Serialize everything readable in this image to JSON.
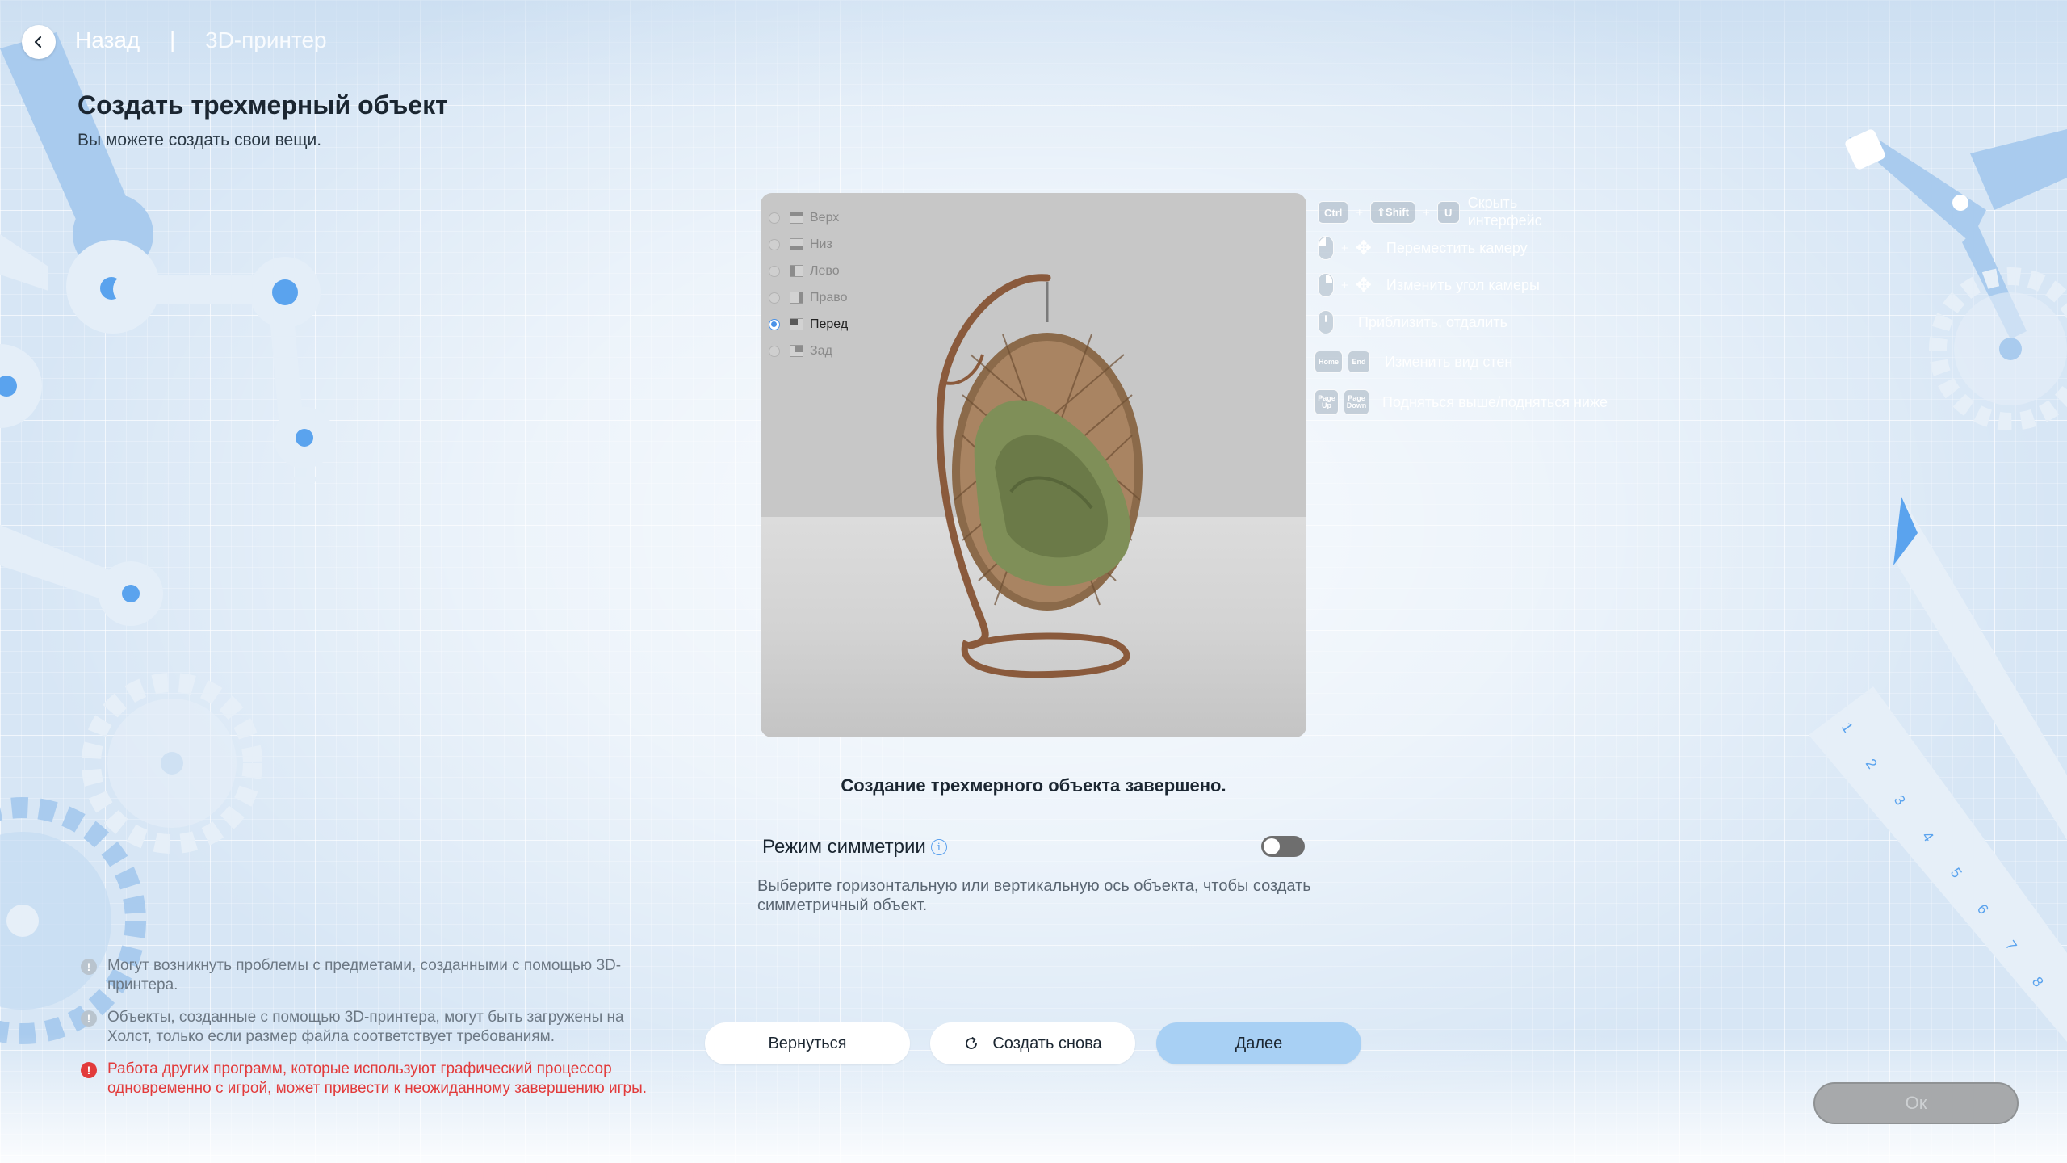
{
  "header": {
    "back_label": "Назад",
    "separator": "|",
    "breadcrumb": "3D-принтер"
  },
  "page": {
    "title": "Создать трехмерный объект",
    "subtitle": "Вы можете создать свои вещи."
  },
  "viewport": {
    "views": [
      {
        "label": "Верх",
        "selected": false,
        "icon": "view-top-icon"
      },
      {
        "label": "Низ",
        "selected": false,
        "icon": "view-bottom-icon"
      },
      {
        "label": "Лево",
        "selected": false,
        "icon": "view-left-icon"
      },
      {
        "label": "Право",
        "selected": false,
        "icon": "view-right-icon"
      },
      {
        "label": "Перед",
        "selected": true,
        "icon": "view-front-icon"
      },
      {
        "label": "Зад",
        "selected": false,
        "icon": "view-back-icon"
      }
    ]
  },
  "controls": {
    "hide_ui": {
      "keys": [
        "Ctrl",
        "⇧Shift",
        "U"
      ],
      "text": "Скрыть интерфейс"
    },
    "move_camera": {
      "text": "Переместить камеру"
    },
    "rotate_camera": {
      "text": "Изменить угол камеры"
    },
    "zoom": {
      "text": "Приблизить, отдалить"
    },
    "wall_view": {
      "keys": [
        "Home",
        "End"
      ],
      "text": "Изменить вид стен"
    },
    "height": {
      "keys": [
        "Page Up",
        "Page Down"
      ],
      "text": "Подняться выше/подняться ниже"
    }
  },
  "status": "Создание трехмерного объекта завершено.",
  "symmetry": {
    "label": "Режим симметрии",
    "enabled": false,
    "description": "Выберите горизонтальную или вертикальную ось объекта, чтобы создать симметричный объект."
  },
  "notes": [
    {
      "type": "info",
      "text": "Могут возникнуть проблемы с предметами, созданными с помощью 3D-принтера."
    },
    {
      "type": "info",
      "text": "Объекты, созданные с помощью 3D-принтера, могут быть загружены на Холст, только если размер файла соответствует требованиям."
    },
    {
      "type": "warning",
      "text": "Работа других программ, которые используют графический процессор одновременно с игрой, может привести к неожиданному завершению игры."
    }
  ],
  "buttons": {
    "back": "Вернуться",
    "retry": "Создать снова",
    "next": "Далее",
    "ok": "Ок"
  },
  "colors": {
    "accent": "#a8d0f4",
    "warning": "#e23b3b",
    "background": "#d7e6f5"
  }
}
